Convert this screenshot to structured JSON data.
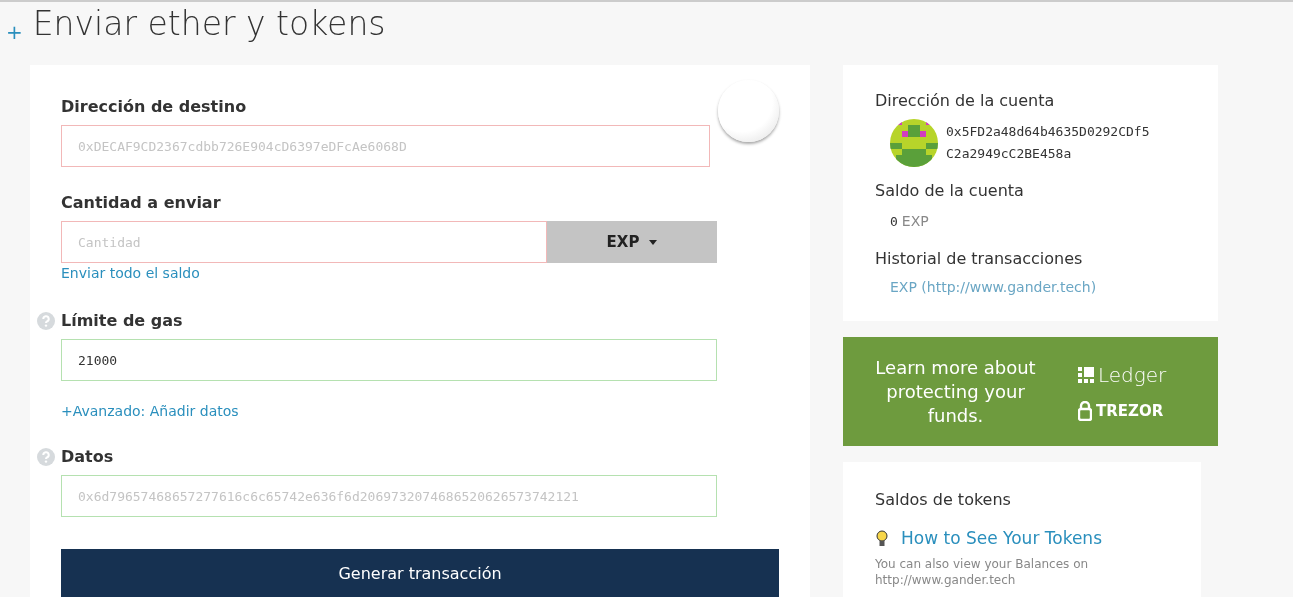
{
  "page_title": {
    "icon": "+",
    "text": "Enviar ether y tokens"
  },
  "form": {
    "fields": [
      {
        "kind": "address",
        "label": "Dirección de destino",
        "placeholder": "0xDECAF9CD2367cdbb726E904cD6397eDFcAe6068D",
        "valid": false,
        "help": false
      },
      {
        "kind": "amount",
        "label": "Cantidad a enviar",
        "placeholder": "Cantidad",
        "valid": false,
        "help": false,
        "unit": "EXP",
        "link": "Enviar todo el saldo"
      },
      {
        "kind": "plain",
        "label": "Límite de gas",
        "value": "21000",
        "valid": true,
        "help": true,
        "link": "+Avanzado: Añadir datos"
      },
      {
        "kind": "plain",
        "label": "Datos",
        "placeholder": "0x6d79657468657277616c6c65742e636f6d2069732074686520626573742121",
        "valid": true,
        "help": true
      }
    ],
    "submit": "Generar transacción"
  },
  "account": {
    "address_title": "Dirección de la cuenta",
    "address_lines": [
      "0x5FD2a48d64b4635D0292CDf5",
      "C2a2949cC2BE458a"
    ],
    "balance_title": "Saldo de la cuenta",
    "balance_amount": "0",
    "balance_unit": "EXP",
    "history_title": "Historial de transacciones",
    "history_link": "EXP (http://www.gander.tech)"
  },
  "promo": {
    "text": "Learn more about protecting your funds.",
    "brands": [
      "Ledger",
      "TREZOR"
    ]
  },
  "tokens": {
    "title": "Saldos de tokens",
    "link": "How to See Your Tokens",
    "note": "You can also view your Balances on",
    "note_link": "http://www.gander.tech"
  }
}
